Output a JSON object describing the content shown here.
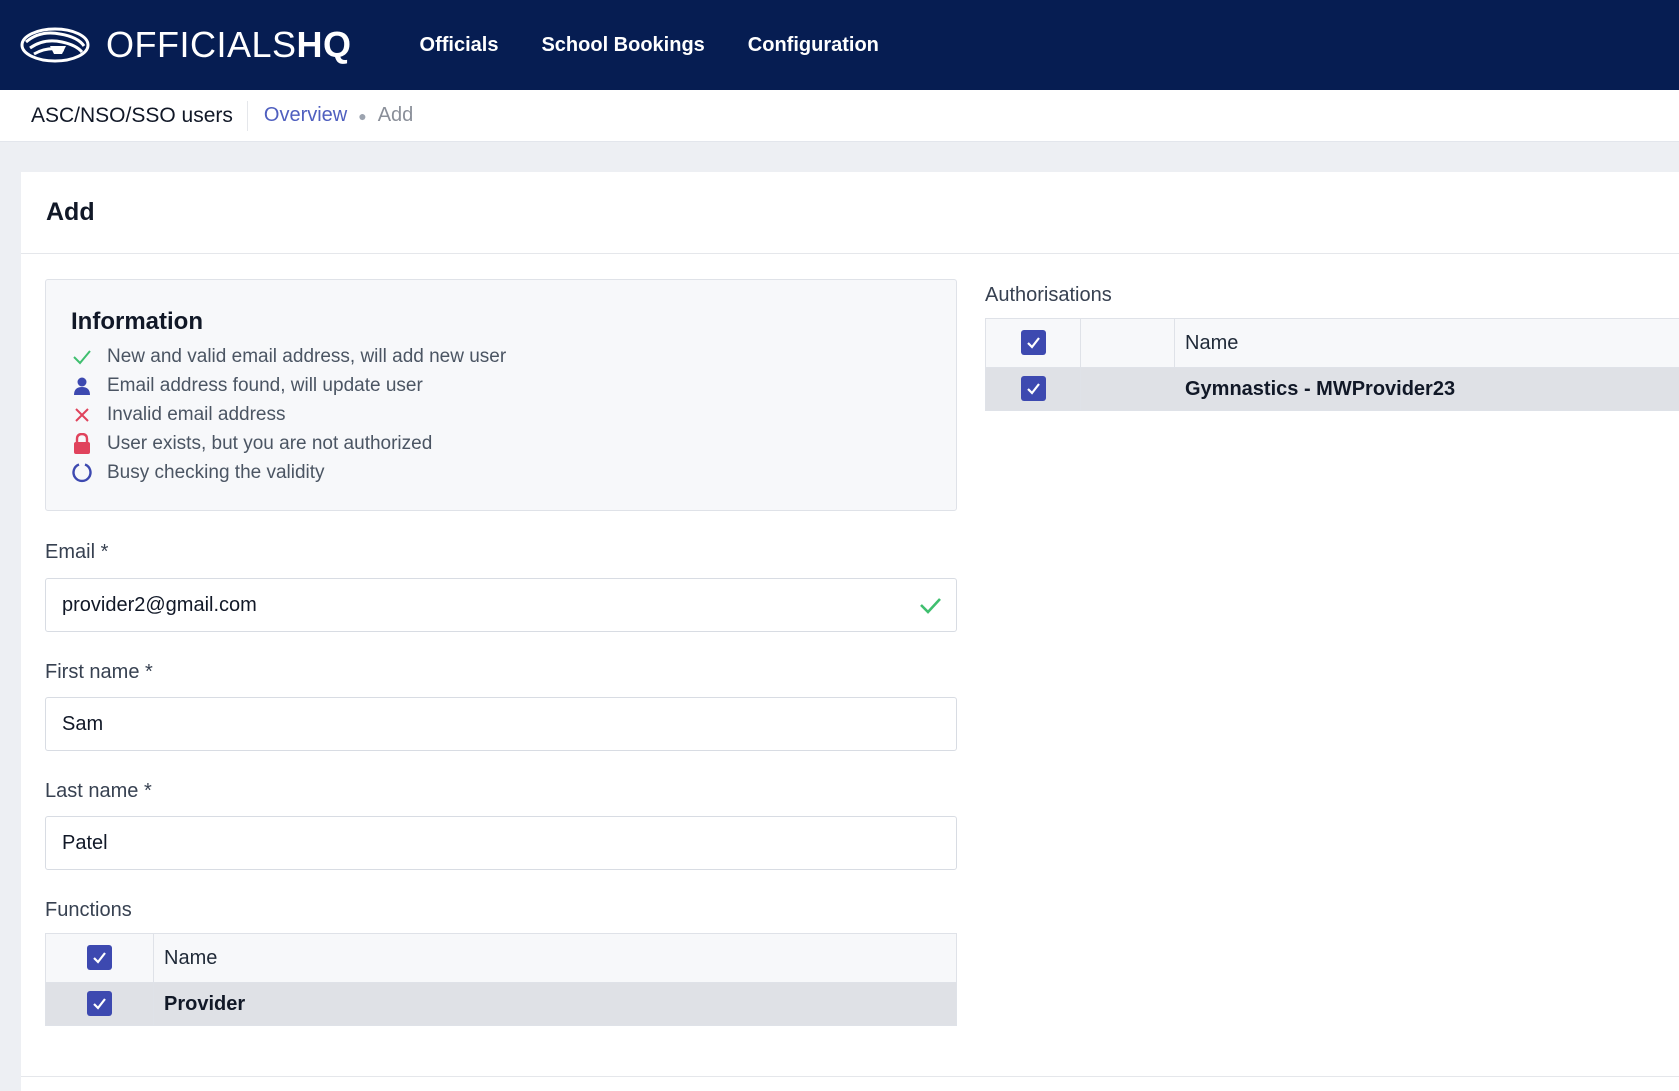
{
  "app": {
    "logo_text_light": "OFFICIALS",
    "logo_text_bold": "HQ",
    "nav": [
      {
        "label": "Officials"
      },
      {
        "label": "School Bookings"
      },
      {
        "label": "Configuration"
      }
    ]
  },
  "breadcrumb": {
    "section": "ASC/NSO/SSO users",
    "link": "Overview",
    "current": "Add"
  },
  "card": {
    "title": "Add"
  },
  "information": {
    "title": "Information",
    "items": [
      {
        "icon": "check-icon",
        "text": "New and valid email address, will add new user"
      },
      {
        "icon": "user-icon",
        "text": "Email address found, will update user"
      },
      {
        "icon": "cross-icon",
        "text": "Invalid email address"
      },
      {
        "icon": "lock-icon",
        "text": "User exists, but you are not authorized"
      },
      {
        "icon": "spinner-icon",
        "text": "Busy checking the validity"
      }
    ]
  },
  "form": {
    "email": {
      "label": "Email *",
      "value": "provider2@gmail.com"
    },
    "first_name": {
      "label": "First name *",
      "value": "Sam"
    },
    "last_name": {
      "label": "Last name *",
      "value": "Patel"
    }
  },
  "functions": {
    "label": "Functions",
    "header_name": "Name",
    "rows": [
      {
        "name": "Provider",
        "checked": true
      }
    ]
  },
  "authorisations": {
    "label": "Authorisations",
    "header_name": "Name",
    "rows": [
      {
        "name": "Gymnastics - MWProvider23",
        "checked": true
      }
    ]
  },
  "colors": {
    "nav_bg": "#061d52",
    "accent": "#3d49b0",
    "link": "#4f5fbf",
    "valid": "#3fbf6f",
    "invalid": "#e0435c"
  }
}
